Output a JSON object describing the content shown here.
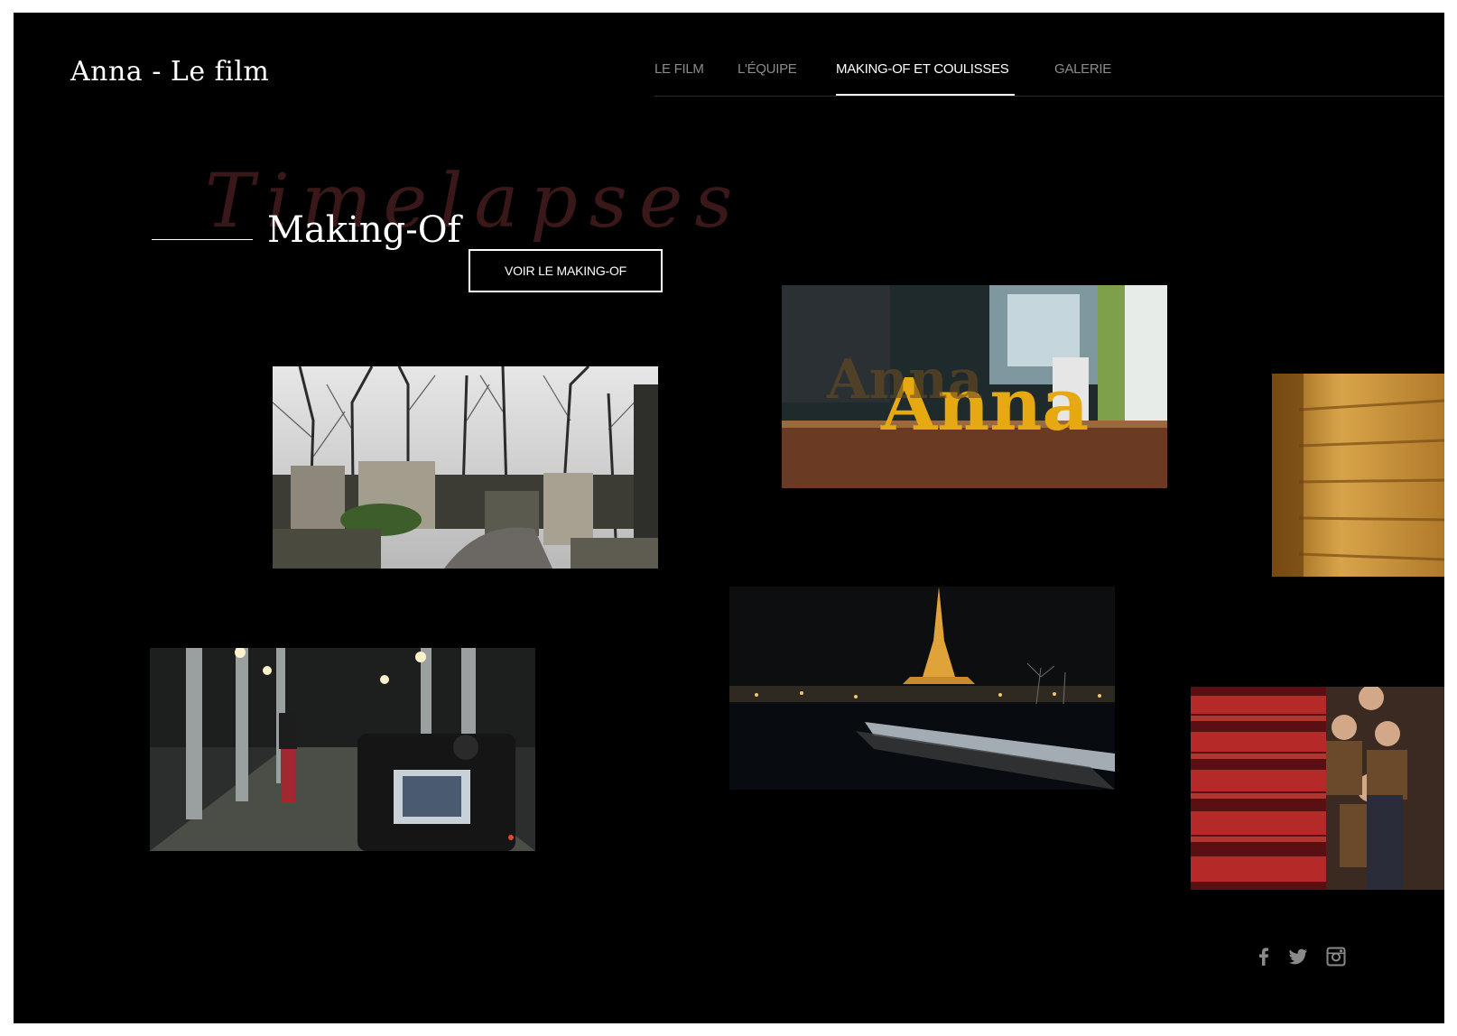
{
  "site": {
    "title": "Anna - Le film"
  },
  "nav": {
    "items": [
      {
        "label": "LE FILM"
      },
      {
        "label": "L'ÉQUIPE"
      },
      {
        "label": "MAKING-OF ET COULISSES"
      },
      {
        "label": "GALERIE"
      }
    ],
    "active_index": 2
  },
  "section": {
    "background_title": "Timelapses",
    "title": "Making-Of",
    "cta_label": "VOIR LE MAKING-OF"
  },
  "photos": [
    {
      "name": "cemetery-photo",
      "subject": "cemetery path"
    },
    {
      "name": "anna-letters-photo",
      "subject": "yellow Anna letters",
      "text": "Anna"
    },
    {
      "name": "golden-wall-photo",
      "subject": "golden stone wall"
    },
    {
      "name": "eiffel-night-photo",
      "subject": "Eiffel Tower at night"
    },
    {
      "name": "camera-bridge-photo",
      "subject": "camera under bridge"
    },
    {
      "name": "theater-crew-photo",
      "subject": "crew in theater seats"
    }
  ],
  "social": [
    {
      "icon": "facebook-icon"
    },
    {
      "icon": "twitter-icon"
    },
    {
      "icon": "instagram-icon"
    }
  ],
  "colors": {
    "background": "#000000",
    "accent_bg_title": "#3a1718",
    "nav_inactive": "#8c8c8c",
    "text": "#ffffff"
  }
}
